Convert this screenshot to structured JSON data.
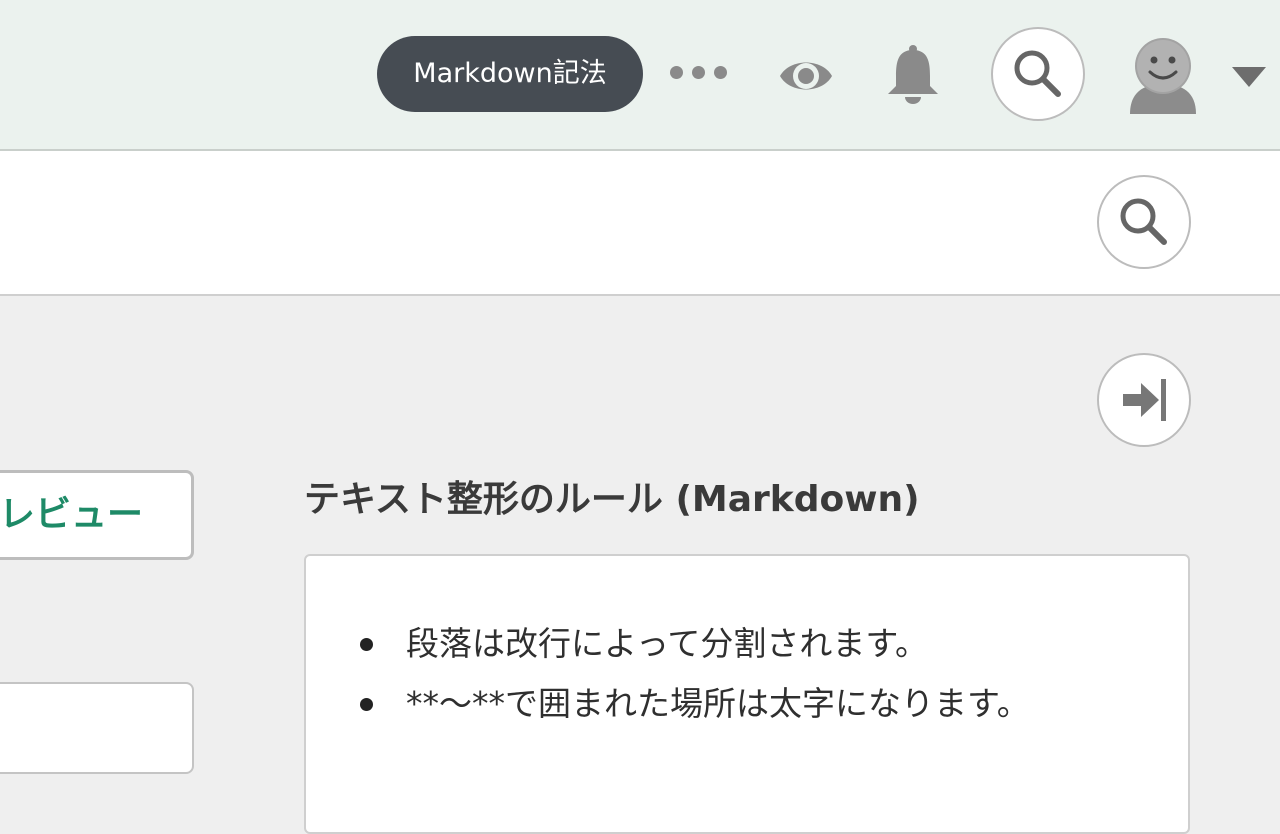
{
  "header": {
    "tooltip": "Markdown記法",
    "icons": [
      "more-dots-icon",
      "eye-icon",
      "bell-icon",
      "search-icon",
      "avatar",
      "caret-down-icon"
    ]
  },
  "preview_button": {
    "label": "レビュー"
  },
  "help": {
    "title": "テキスト整形のルール (Markdown)",
    "rules": [
      "段落は改行によって分割されます。",
      "**〜**で囲まれた場所は太字になります。"
    ]
  },
  "colors": {
    "header_bg": "#ebf2ee",
    "tooltip_bg": "#464c53",
    "accent_green": "#1e8a67",
    "page_bg": "#efefef"
  }
}
